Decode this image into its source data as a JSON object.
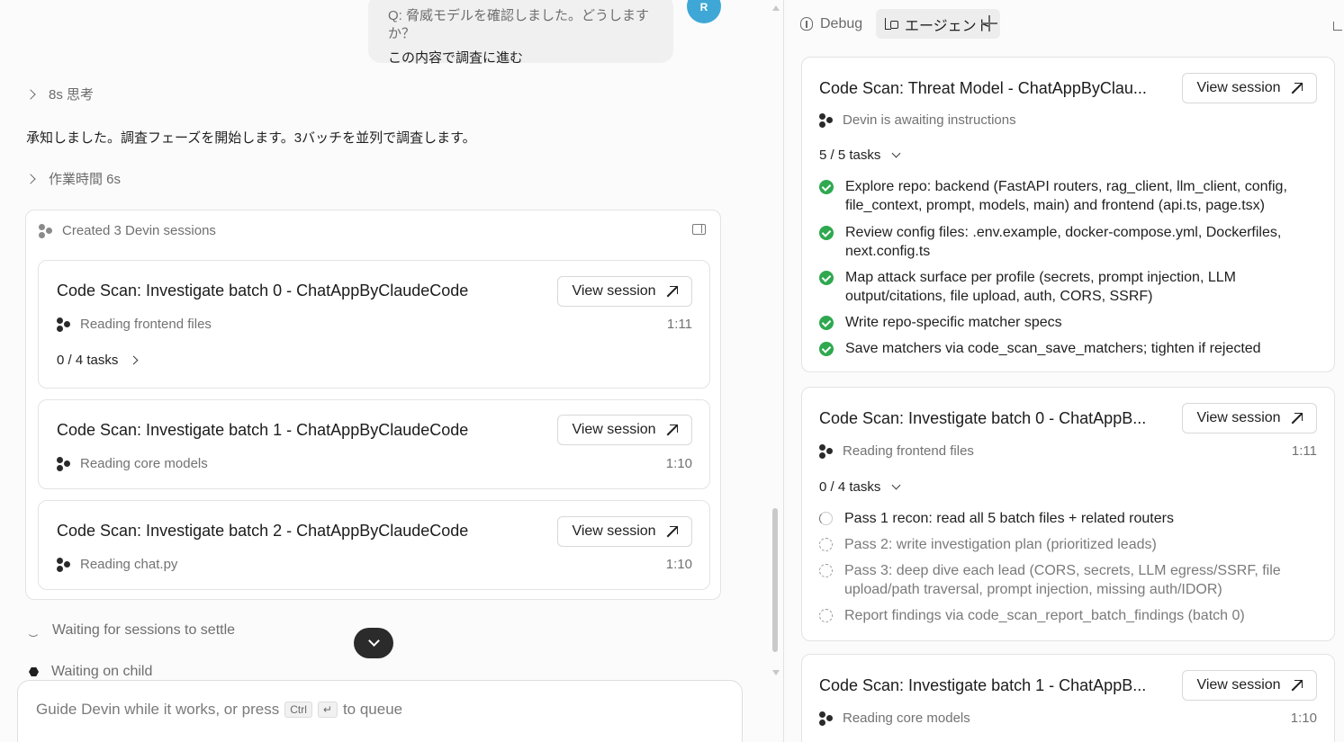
{
  "chat": {
    "user_question": "Q: 脅威モデルを確認しました。どうしますか？",
    "user_answer": "この内容で調査に進む",
    "avatar_initial": "R",
    "thinking_label": "8s 思考",
    "reply": "承知しました。調査フェーズを開始します。3バッチを並列で調査します。",
    "worktime_label": "作業時間 6s",
    "sessions_header": "Created 3 Devin sessions",
    "sessions": [
      {
        "title": "Code Scan: Investigate batch 0 - ChatAppByClaudeCode",
        "status": "Reading frontend files",
        "time": "1:11",
        "tasks": "0 / 4 tasks"
      },
      {
        "title": "Code Scan: Investigate batch 1 - ChatAppByClaudeCode",
        "status": "Reading core models",
        "time": "1:10"
      },
      {
        "title": "Code Scan: Investigate batch 2 - ChatAppByClaudeCode",
        "status": "Reading chat.py",
        "time": "1:10"
      }
    ],
    "view_session_label": "View session",
    "waiting_settle": "Waiting for sessions to settle",
    "waiting_child": "Waiting on child",
    "composer": {
      "placeholder_before": "Guide Devin while it works, or press",
      "kbd_ctrl": "Ctrl",
      "kbd_enter": "↵",
      "placeholder_after": "to queue"
    }
  },
  "right_panel": {
    "tabs": [
      {
        "label": "Debug"
      },
      {
        "label": "エージェント"
      }
    ],
    "cards": [
      {
        "title": "Code Scan: Threat Model - ChatAppByClau...",
        "status": "Devin is awaiting instructions",
        "tasks_summary": "5 / 5 tasks",
        "tasks": [
          {
            "text": "Explore repo: backend (FastAPI routers, rag_client, llm_client, config, file_context, prompt, models, main) and frontend (api.ts, page.tsx)",
            "state": "done"
          },
          {
            "text": "Review config files: .env.example, docker-compose.yml, Dockerfiles, next.config.ts",
            "state": "done"
          },
          {
            "text": "Map attack surface per profile (secrets, prompt injection, LLM output/citations, file upload, auth, CORS, SSRF)",
            "state": "done"
          },
          {
            "text": "Write repo-specific matcher specs",
            "state": "done"
          },
          {
            "text": "Save matchers via code_scan_save_matchers; tighten if rejected",
            "state": "done"
          }
        ]
      },
      {
        "title": "Code Scan: Investigate batch 0 - ChatAppB...",
        "status": "Reading frontend files",
        "time": "1:11",
        "tasks_summary": "0 / 4 tasks",
        "tasks": [
          {
            "text": "Pass 1 recon: read all 5 batch files + related routers",
            "state": "in-progress"
          },
          {
            "text": "Pass 2: write investigation plan (prioritized leads)",
            "state": "pending"
          },
          {
            "text": "Pass 3: deep dive each lead (CORS, secrets, LLM egress/SSRF, file upload/path traversal, prompt injection, missing auth/IDOR)",
            "state": "pending"
          },
          {
            "text": "Report findings via code_scan_report_batch_findings (batch 0)",
            "state": "pending"
          }
        ]
      },
      {
        "title": "Code Scan: Investigate batch 1 - ChatAppB...",
        "status": "Reading core models",
        "time": "1:10"
      }
    ]
  },
  "colors": {
    "success": "#2fa84f",
    "avatar": "#3ea7d6",
    "scroll_button": "#2b2b2b"
  }
}
